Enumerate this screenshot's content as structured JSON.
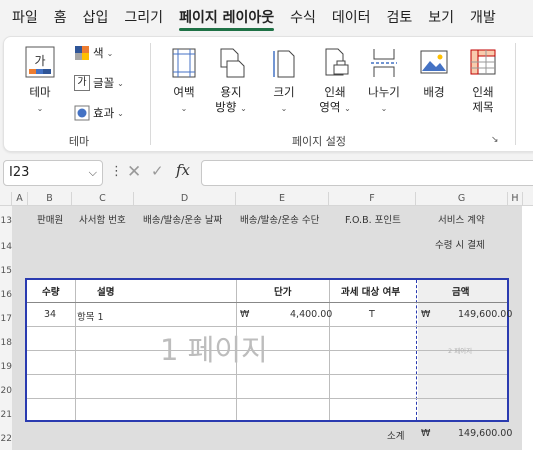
{
  "menu": {
    "tabs": [
      "파일",
      "홈",
      "삽입",
      "그리기",
      "페이지 레이아웃",
      "수식",
      "데이터",
      "검토",
      "보기",
      "개발"
    ],
    "active": "페이지 레이아웃"
  },
  "ribbon": {
    "theme_group": {
      "label": "테마",
      "theme_button": "테마",
      "theme_icon_text": "가",
      "colors": "색",
      "fonts": "글꼴",
      "fonts_icon_text": "가",
      "effects": "효과"
    },
    "page_setup_group": {
      "label": "페이지 설정",
      "margins": "여백",
      "orientation_line1": "용지",
      "orientation_line2": "방향",
      "size": "크기",
      "print_area_line1": "인쇄",
      "print_area_line2": "영역",
      "breaks": "나누기",
      "background": "배경",
      "print_titles_line1": "인쇄",
      "print_titles_line2": "제목"
    }
  },
  "formula_bar": {
    "name_box": "I23",
    "formula": ""
  },
  "sheet": {
    "columns": [
      "A",
      "B",
      "C",
      "D",
      "E",
      "F",
      "G",
      "H"
    ],
    "rows": [
      "13",
      "14",
      "15",
      "16",
      "17",
      "18",
      "19",
      "20",
      "21",
      "22"
    ],
    "header_row13": {
      "b": "판매원",
      "c": "사서함 번호",
      "d": "배송/발송/운송 날짜",
      "e": "배송/발송/운송 수단",
      "f": "F.O.B. 포인트",
      "g": "서비스 계약"
    },
    "row14_g": "수령 시 결제",
    "table": {
      "headers": {
        "qty": "수량",
        "desc": "설명",
        "price": "단가",
        "tax": "과세 대상 여부",
        "amount": "금액"
      },
      "row1": {
        "qty": "34",
        "desc": "항목 1",
        "price_sym": "₩",
        "price": "4,400.00",
        "tax": "T",
        "amount_sym": "₩",
        "amount": "149,600.00"
      }
    },
    "subtotal": {
      "label": "소계",
      "sym": "₩",
      "value": "149,600.00"
    },
    "watermark_page1": "1 페이지",
    "watermark_page2": "2 페이지"
  }
}
